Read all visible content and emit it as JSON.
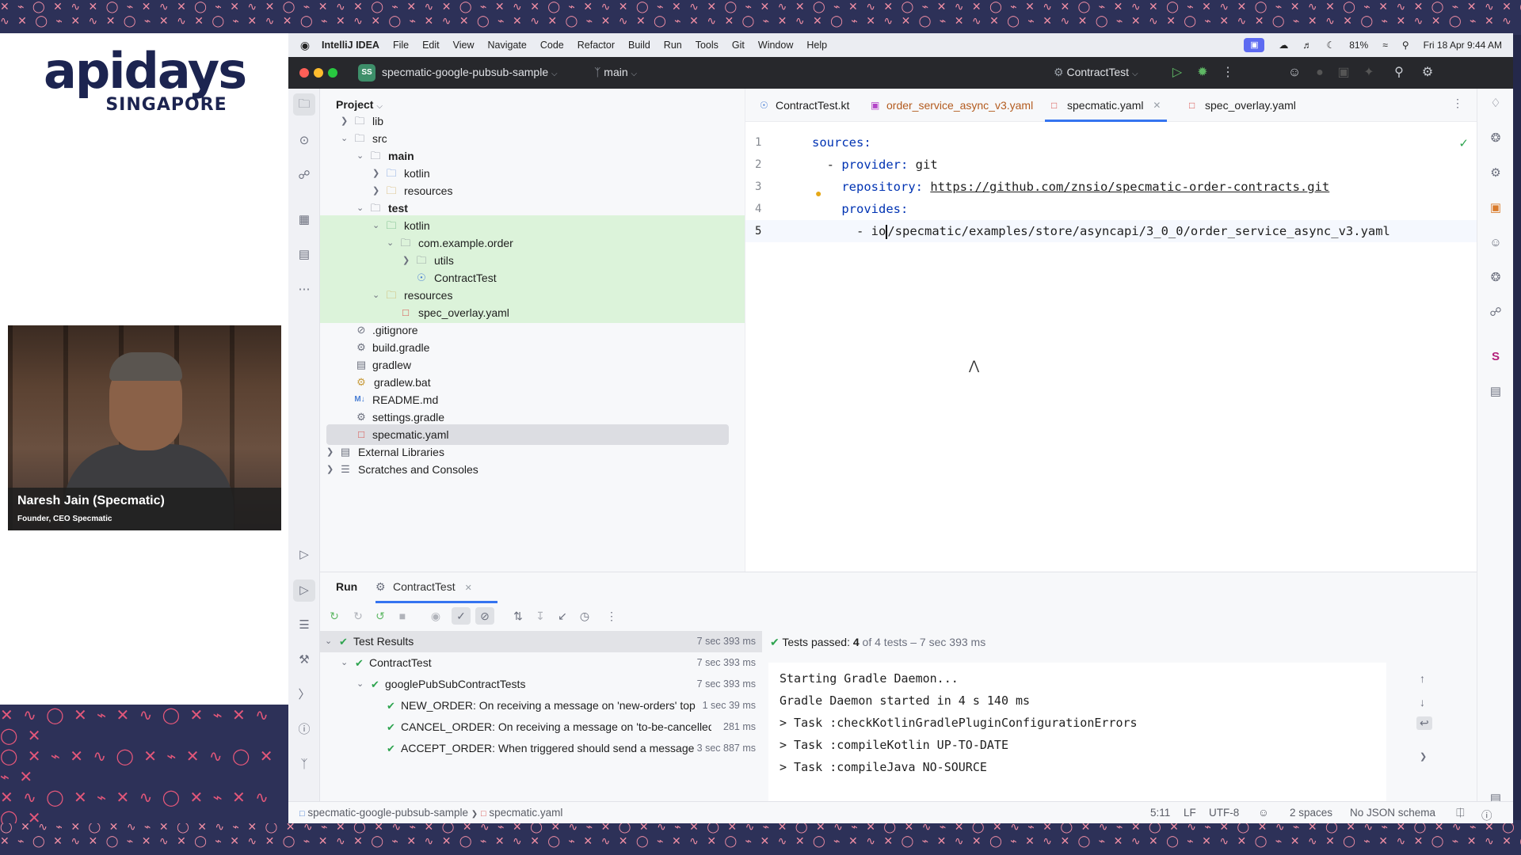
{
  "conference": {
    "logo_main": "apidays",
    "logo_sub": "SINGAPORE"
  },
  "speaker": {
    "name": "Naresh Jain (Specmatic)",
    "title": "Founder, CEO Specmatic"
  },
  "menubar": {
    "app": "IntelliJ IDEA",
    "items": [
      "File",
      "Edit",
      "View",
      "Navigate",
      "Code",
      "Refactor",
      "Build",
      "Run",
      "Tools",
      "Git",
      "Window",
      "Help"
    ],
    "battery": "81%",
    "clock": "Fri 18 Apr  9:44 AM"
  },
  "titlebar": {
    "project_badge": "SS",
    "project": "specmatic-google-pubsub-sample",
    "branch": "main",
    "run_config": "ContractTest"
  },
  "project_panel": {
    "title": "Project",
    "tree": [
      {
        "label": "lib"
      },
      {
        "label": "src"
      },
      {
        "label": "main"
      },
      {
        "label": "kotlin"
      },
      {
        "label": "resources"
      },
      {
        "label": "test"
      },
      {
        "label": "kotlin"
      },
      {
        "label": "com.example.order"
      },
      {
        "label": "utils"
      },
      {
        "label": "ContractTest"
      },
      {
        "label": "resources"
      },
      {
        "label": "spec_overlay.yaml"
      },
      {
        "label": ".gitignore"
      },
      {
        "label": "build.gradle"
      },
      {
        "label": "gradlew"
      },
      {
        "label": "gradlew.bat"
      },
      {
        "label": "README.md"
      },
      {
        "label": "settings.gradle"
      },
      {
        "label": "specmatic.yaml"
      },
      {
        "label": "External Libraries"
      },
      {
        "label": "Scratches and Consoles"
      }
    ]
  },
  "editor": {
    "tabs": [
      {
        "label": "ContractTest.kt"
      },
      {
        "label": "order_service_async_v3.yaml"
      },
      {
        "label": "specmatic.yaml"
      },
      {
        "label": "spec_overlay.yaml"
      }
    ],
    "lines": [
      {
        "num": "1",
        "key": "sources:"
      },
      {
        "num": "2",
        "prefix": "  - ",
        "key": "provider:",
        "value": " git"
      },
      {
        "num": "3",
        "prefix": "    ",
        "key": "repository:",
        "value": "https://github.com/znsio/specmatic-order-contracts.git"
      },
      {
        "num": "4",
        "prefix": "    ",
        "key": "provides:"
      },
      {
        "num": "5",
        "prefix": "      - ",
        "pre_caret": "io",
        "post_caret": "/specmatic/examples/store/asyncapi/3_0_0/order_service_async_v3.yaml"
      }
    ]
  },
  "run_panel": {
    "label": "Run",
    "tab": "ContractTest",
    "results": [
      {
        "name": "Test Results",
        "time": "7 sec 393 ms"
      },
      {
        "name": "ContractTest",
        "time": "7 sec 393 ms"
      },
      {
        "name": "googlePubSubContractTests",
        "time": "7 sec 393 ms"
      },
      {
        "name": "NEW_ORDER: On receiving a message on 'new-orders' topic, should send a",
        "time": "1 sec 39 ms"
      },
      {
        "name": "CANCEL_ORDER: On receiving a message on 'to-be-cancelled-orders' topic, sh",
        "time": "281 ms"
      },
      {
        "name": "ACCEPT_ORDER: When triggered should send a message on the 'accepted",
        "time": "3 sec 887 ms"
      }
    ],
    "summary": {
      "prefix": "Tests passed: ",
      "count": "4",
      "suffix": " of 4 tests – 7 sec 393 ms"
    },
    "console": [
      "Starting Gradle Daemon...",
      "Gradle Daemon started in 4 s 140 ms",
      "> Task :checkKotlinGradlePluginConfigurationErrors",
      "> Task :compileKotlin UP-TO-DATE",
      "> Task :compileJava NO-SOURCE"
    ]
  },
  "statusbar": {
    "crumb_project": "specmatic-google-pubsub-sample",
    "crumb_file": "specmatic.yaml",
    "position": "5:11",
    "line_sep": "LF",
    "encoding": "UTF-8",
    "indent": "2 spaces",
    "schema": "No JSON schema"
  },
  "colors": {
    "accent": "#3574f0",
    "test_pass": "#2ea44f",
    "highlight_green": "#dcf3da"
  }
}
